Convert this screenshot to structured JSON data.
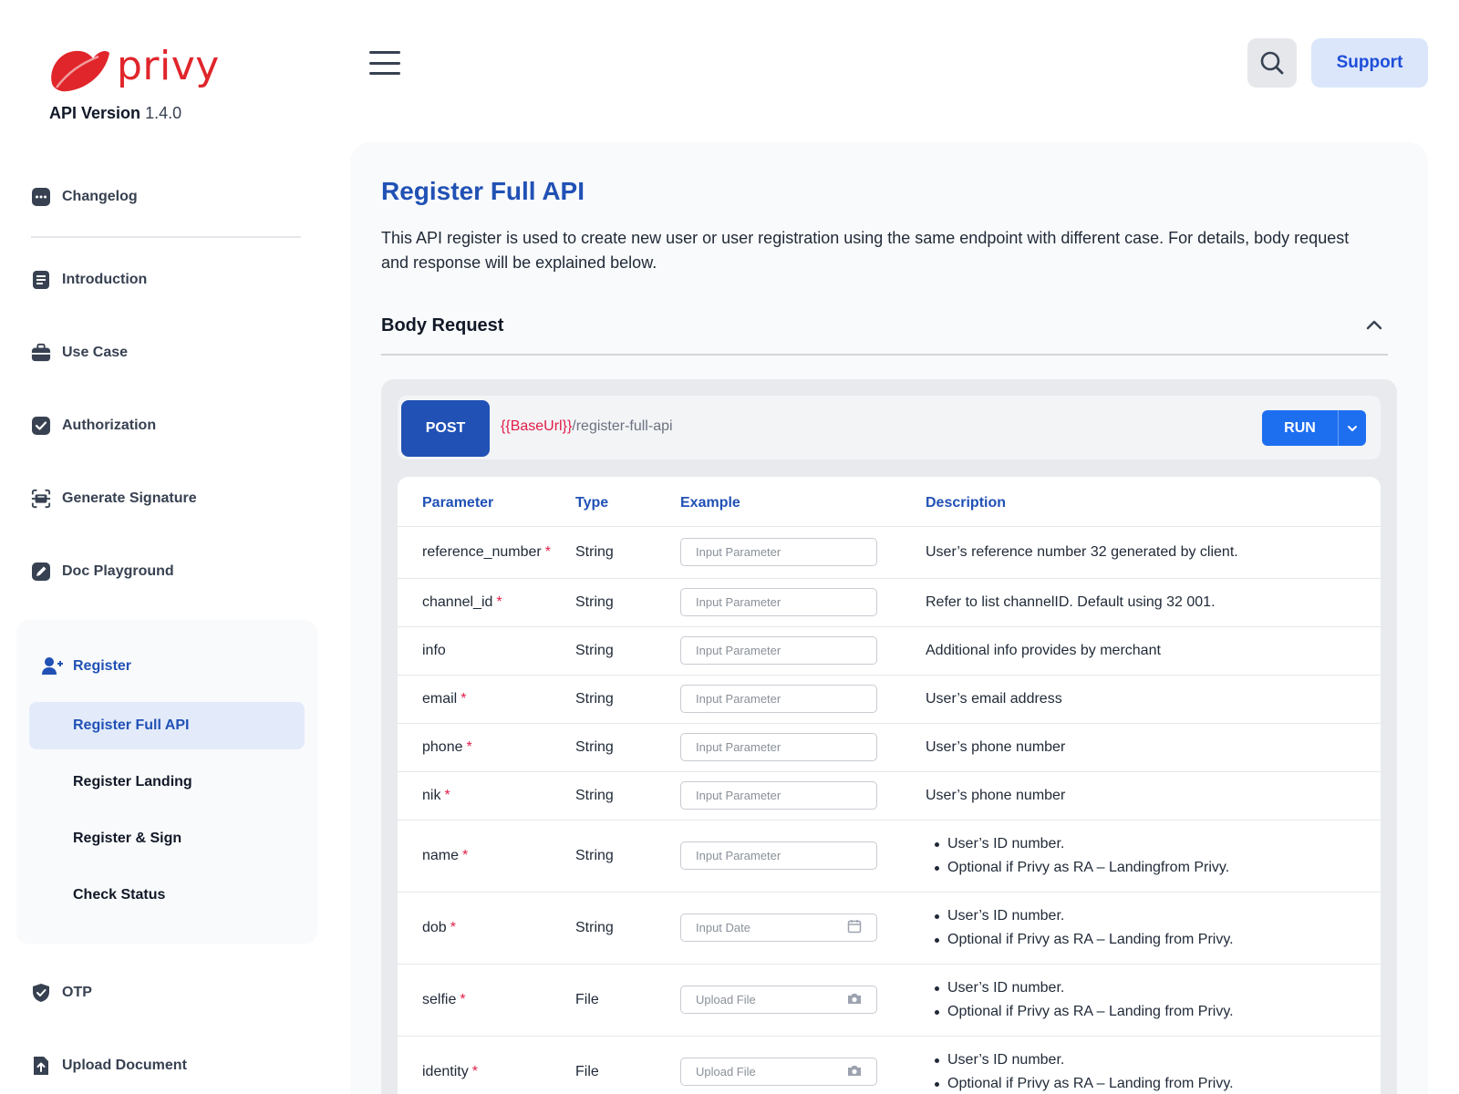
{
  "brand": {
    "name": "privy",
    "version_label": "API Version",
    "version": "1.4.0",
    "color": "#e0262b"
  },
  "header": {
    "support_label": "Support"
  },
  "sidebar": {
    "items": [
      {
        "label": "Changelog",
        "icon": "chat-bubble-icon"
      },
      {
        "label": "Introduction",
        "icon": "document-icon"
      },
      {
        "label": "Use Case",
        "icon": "briefcase-icon"
      },
      {
        "label": "Authorization",
        "icon": "checkbox-icon"
      },
      {
        "label": "Generate Signature",
        "icon": "signature-scan-icon"
      },
      {
        "label": "Doc Playground",
        "icon": "edit-icon"
      }
    ],
    "group": {
      "label": "Register",
      "icon": "add-user-icon",
      "items": [
        "Register Full API",
        "Register Landing",
        "Register & Sign",
        "Check Status"
      ],
      "active": "Register Full API"
    },
    "after": [
      {
        "label": "OTP",
        "icon": "shield-check-icon"
      },
      {
        "label": "Upload Document",
        "icon": "upload-document-icon"
      }
    ]
  },
  "main": {
    "title": "Register Full API",
    "description": "This API register is used to create new user or user registration using the same endpoint with different case. For details, body request and response will be explained below.",
    "section_title": "Body Request",
    "method": "POST",
    "url_base": "{{BaseUrl}}",
    "url_path": "/register-full-api",
    "run_label": "RUN",
    "columns": [
      "Parameter",
      "Type",
      "Example",
      "Description"
    ],
    "rows": [
      {
        "param": "reference_number",
        "required": "*",
        "type": "String",
        "placeholder": "Input Parameter",
        "desc": [
          "User’s reference number 32 generated by client."
        ]
      },
      {
        "param": "channel_id",
        "required": "*",
        "type": "String",
        "placeholder": "Input Parameter",
        "desc": [
          "Refer to list channelID. Default using 32 001."
        ]
      },
      {
        "param": "info",
        "required": "",
        "type": "String",
        "placeholder": "Input Parameter",
        "desc": [
          "Additional info provides by merchant"
        ]
      },
      {
        "param": "email",
        "required": "*",
        "type": "String",
        "placeholder": "Input Parameter",
        "desc": [
          "User’s email address"
        ]
      },
      {
        "param": "phone",
        "required": "*",
        "type": "String",
        "placeholder": "Input Parameter",
        "desc": [
          "User’s phone number"
        ]
      },
      {
        "param": "nik",
        "required": "*",
        "type": "String",
        "placeholder": "Input Parameter",
        "desc": [
          "User’s phone number"
        ]
      },
      {
        "param": "name",
        "required": "*",
        "type": "String",
        "placeholder": "Input Parameter",
        "bullets": [
          "User’s ID number.",
          "Optional if Privy as RA – Landingfrom Privy."
        ]
      },
      {
        "param": "dob",
        "required": "*",
        "type": "String",
        "placeholder": "Input Date",
        "icon": "calendar-icon",
        "bullets": [
          "User’s ID number.",
          "Optional if Privy as RA – Landing from Privy."
        ]
      },
      {
        "param": "selfie",
        "required": "*",
        "type": "File",
        "placeholder": "Upload File",
        "icon": "camera-icon",
        "bullets": [
          "User’s ID number.",
          "Optional if Privy as RA – Landing from Privy."
        ]
      },
      {
        "param": "identity",
        "required": "*",
        "type": "File",
        "placeholder": "Upload File",
        "icon": "camera-icon",
        "bullets": [
          "User’s ID number.",
          "Optional if Privy as RA – Landing from Privy."
        ]
      }
    ]
  },
  "colors": {
    "accent": "#2151b5",
    "run": "#1e6ef0",
    "required": "#e11d48",
    "support_bg": "#dbe6fb"
  }
}
